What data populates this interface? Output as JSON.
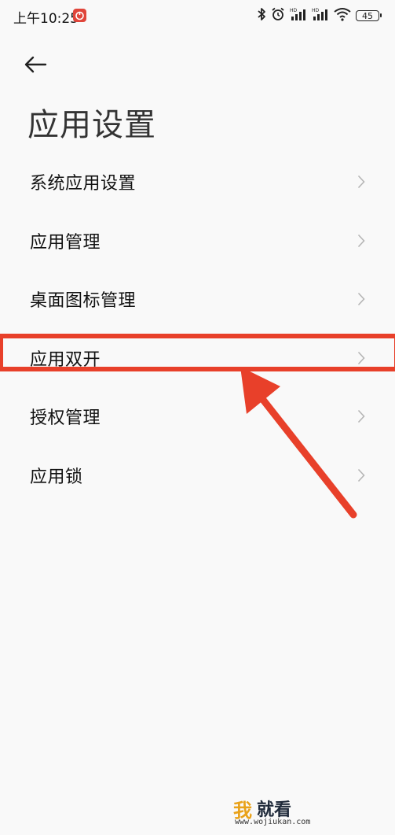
{
  "status_bar": {
    "time": "上午10:25",
    "battery": "45"
  },
  "header": {
    "title": "应用设置"
  },
  "menu": {
    "items": [
      {
        "label": "系统应用设置"
      },
      {
        "label": "应用管理"
      },
      {
        "label": "桌面图标管理"
      },
      {
        "label": "应用双开"
      },
      {
        "label": "授权管理"
      },
      {
        "label": "应用锁"
      }
    ]
  },
  "watermark": {
    "brand_part1": "我",
    "brand_part2": "就看",
    "url": "www.wojiukan.com"
  },
  "colors": {
    "highlight": "#e8402a",
    "chevron": "#b5b5b5",
    "background": "#f9f9f9"
  },
  "icons": [
    "bluetooth-icon",
    "alarm-icon",
    "signal-icon",
    "wifi-icon",
    "battery-icon",
    "back-arrow-icon",
    "chevron-right-icon"
  ]
}
